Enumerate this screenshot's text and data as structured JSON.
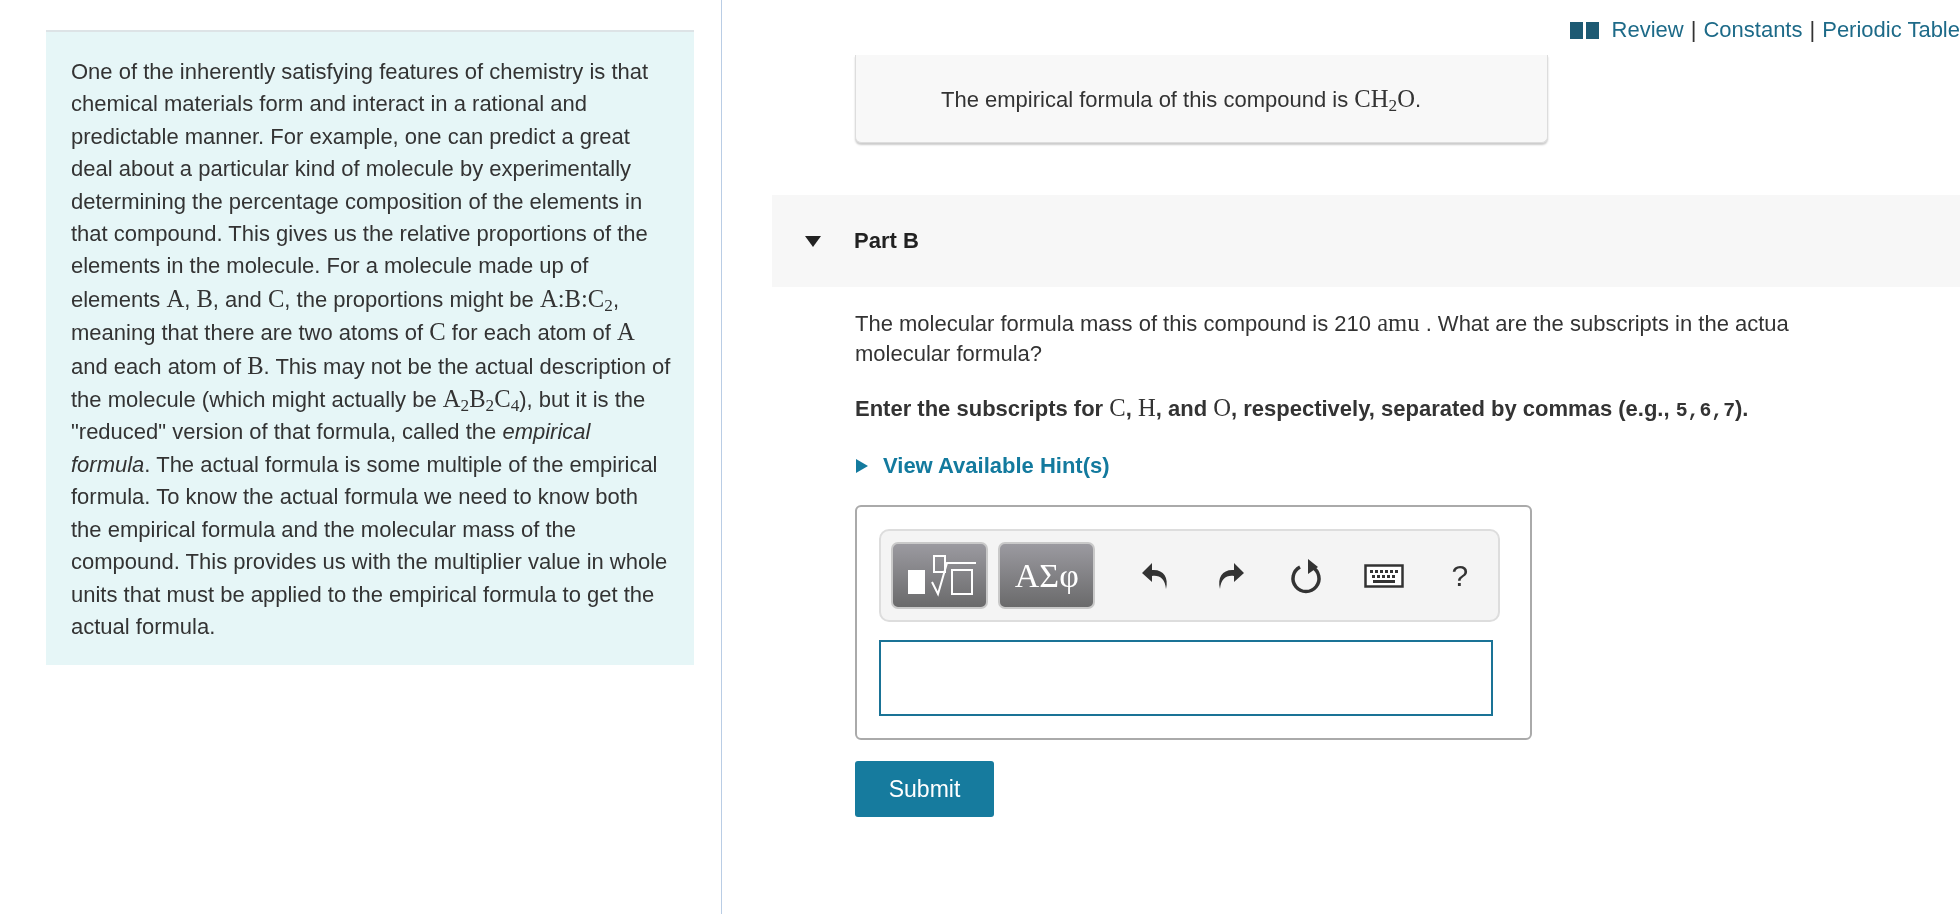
{
  "passage": {
    "segments": [
      {
        "kind": "text",
        "text": "One of the inherently satisfying features of chemistry is that chemical materials form and interact in a rational and predictable manner. For example, one can predict a great deal about a particular kind of molecule by experimentally determining the percentage composition of the elements in that compound. This gives us the relative proportions of the elements in the molecule. For a molecule made up of elements "
      },
      {
        "kind": "math",
        "text": "A"
      },
      {
        "kind": "text",
        "text": ", "
      },
      {
        "kind": "math",
        "text": "B"
      },
      {
        "kind": "text",
        "text": ", and "
      },
      {
        "kind": "math",
        "text": "C"
      },
      {
        "kind": "text",
        "text": ", the proportions might be "
      },
      {
        "kind": "math",
        "text": "A:B:C$_{2}$"
      },
      {
        "kind": "text",
        "text": ", meaning that there are two atoms of "
      },
      {
        "kind": "math",
        "text": "C"
      },
      {
        "kind": "text",
        "text": " for each atom of "
      },
      {
        "kind": "math",
        "text": "A"
      },
      {
        "kind": "text",
        "text": " and each atom of "
      },
      {
        "kind": "math",
        "text": "B"
      },
      {
        "kind": "text",
        "text": ". This may not be the actual description of the molecule (which might actually be "
      },
      {
        "kind": "math",
        "text": "A$_{2}$B$_{2}$C$_{4}$"
      },
      {
        "kind": "text",
        "text": "), but it is the \"reduced\" version of that formula, called the *empirical formula*. The actual formula is some multiple of the empirical formula. To know the actual formula we need to know both the empirical formula and the molecular mass of the compound. This provides us with the multiplier value in whole units that must be applied to the empirical formula to get the actual formula."
      }
    ]
  },
  "links": {
    "separator": "|",
    "items": [
      {
        "label": "Review"
      },
      {
        "label": "Constants"
      },
      {
        "label": "Periodic Table"
      }
    ]
  },
  "given": {
    "segments": [
      {
        "kind": "text",
        "text": "The empirical formula of this compound is "
      },
      {
        "kind": "math",
        "text": "CH$_{2}$O"
      },
      {
        "kind": "text",
        "text": "."
      }
    ]
  },
  "part": {
    "title": "Part B",
    "expanded": true,
    "question_lines": [
      [
        {
          "kind": "text",
          "text": "The molecular formula mass of this compound is 210 "
        },
        {
          "kind": "math",
          "text": "amu"
        },
        {
          "kind": "text",
          "text": " . What are the subscripts in the actua"
        }
      ],
      [
        {
          "kind": "text",
          "text": "molecular formula?"
        }
      ]
    ],
    "instruction": [
      {
        "kind": "text",
        "text": "Enter the subscripts for "
      },
      {
        "kind": "math",
        "text": "C"
      },
      {
        "kind": "text",
        "text": ", "
      },
      {
        "kind": "math",
        "text": "H"
      },
      {
        "kind": "text",
        "text": ", and "
      },
      {
        "kind": "math",
        "text": "O"
      },
      {
        "kind": "text",
        "text": ", respectively, separated by commas (e.g., "
      },
      {
        "kind": "code",
        "text": "5,6,7"
      },
      {
        "kind": "text",
        "text": ")."
      }
    ],
    "hint": {
      "label": "View Available Hint(s)",
      "expanded": false
    },
    "toolbar": [
      {
        "kind": "templates"
      },
      {
        "kind": "symbols",
        "label": "ΑΣφ"
      },
      {
        "kind": "undo"
      },
      {
        "kind": "redo"
      },
      {
        "kind": "reset"
      },
      {
        "kind": "keyboard"
      },
      {
        "kind": "help",
        "label": "?"
      }
    ],
    "submit": "Submit"
  }
}
